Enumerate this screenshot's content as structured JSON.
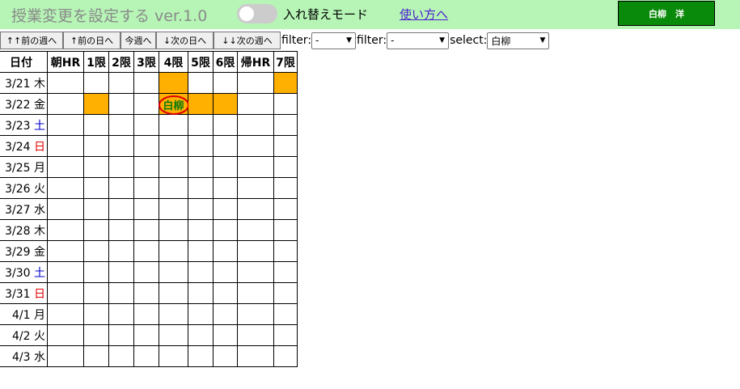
{
  "header": {
    "title": "授業変更を設定する ver.1.0",
    "toggle_label": "入れ替えモード",
    "help_link": "使い方へ",
    "user_button": "白柳　洋"
  },
  "toolbar": {
    "buttons": [
      "↑↑前の週へ",
      "↑前の日へ",
      "今週へ",
      "↓次の日へ",
      "↓↓次の週へ"
    ],
    "filter1_label": "filter:",
    "filter1_value": "-",
    "filter2_label": "filter:",
    "filter2_value": "-",
    "select_label": "select:",
    "select_value": "白柳"
  },
  "table": {
    "headers": [
      "日付",
      "朝HR",
      "1限",
      "2限",
      "3限",
      "4限",
      "5限",
      "6限",
      "帰HR",
      "7限"
    ],
    "rows": [
      {
        "date": "3/21",
        "weekday": "木",
        "type": "weekday",
        "slots": [
          "",
          "",
          "",
          "",
          "on",
          "",
          "",
          "",
          "on"
        ]
      },
      {
        "date": "3/22",
        "weekday": "金",
        "type": "weekday",
        "slots": [
          "",
          "on",
          "",
          "",
          "on",
          "on",
          "on",
          "",
          ""
        ],
        "mark": {
          "slot": 4,
          "text": "白柳"
        }
      },
      {
        "date": "3/23",
        "weekday": "土",
        "type": "sat",
        "slots": [
          "",
          "",
          "",
          "",
          "",
          "",
          "",
          "",
          ""
        ]
      },
      {
        "date": "3/24",
        "weekday": "日",
        "type": "sun",
        "slots": [
          "",
          "",
          "",
          "",
          "",
          "",
          "",
          "",
          ""
        ]
      },
      {
        "date": "3/25",
        "weekday": "月",
        "type": "weekday",
        "slots": [
          "",
          "",
          "",
          "",
          "",
          "",
          "",
          "",
          ""
        ]
      },
      {
        "date": "3/26",
        "weekday": "火",
        "type": "weekday",
        "slots": [
          "",
          "",
          "",
          "",
          "",
          "",
          "",
          "",
          ""
        ]
      },
      {
        "date": "3/27",
        "weekday": "水",
        "type": "weekday",
        "slots": [
          "",
          "",
          "",
          "",
          "",
          "",
          "",
          "",
          ""
        ]
      },
      {
        "date": "3/28",
        "weekday": "木",
        "type": "weekday",
        "slots": [
          "",
          "",
          "",
          "",
          "",
          "",
          "",
          "",
          ""
        ]
      },
      {
        "date": "3/29",
        "weekday": "金",
        "type": "weekday",
        "slots": [
          "",
          "",
          "",
          "",
          "",
          "",
          "",
          "",
          ""
        ]
      },
      {
        "date": "3/30",
        "weekday": "土",
        "type": "sat",
        "slots": [
          "",
          "",
          "",
          "",
          "",
          "",
          "",
          "",
          ""
        ]
      },
      {
        "date": "3/31",
        "weekday": "日",
        "type": "sun",
        "slots": [
          "",
          "",
          "",
          "",
          "",
          "",
          "",
          "",
          ""
        ]
      },
      {
        "date": "4/1",
        "weekday": "月",
        "type": "weekday",
        "slots": [
          "",
          "",
          "",
          "",
          "",
          "",
          "",
          "",
          ""
        ]
      },
      {
        "date": "4/2",
        "weekday": "火",
        "type": "weekday",
        "slots": [
          "",
          "",
          "",
          "",
          "",
          "",
          "",
          "",
          ""
        ]
      },
      {
        "date": "4/3",
        "weekday": "水",
        "type": "weekday",
        "slots": [
          "",
          "",
          "",
          "",
          "",
          "",
          "",
          "",
          ""
        ]
      }
    ]
  },
  "colors": {
    "header_bg": "#b6f5b6",
    "slot_active": "#ffb000",
    "user_button": "#0a8a0a",
    "saturday": "#0000cc",
    "sunday": "#e00000",
    "mark_circle": "#dd0000"
  }
}
